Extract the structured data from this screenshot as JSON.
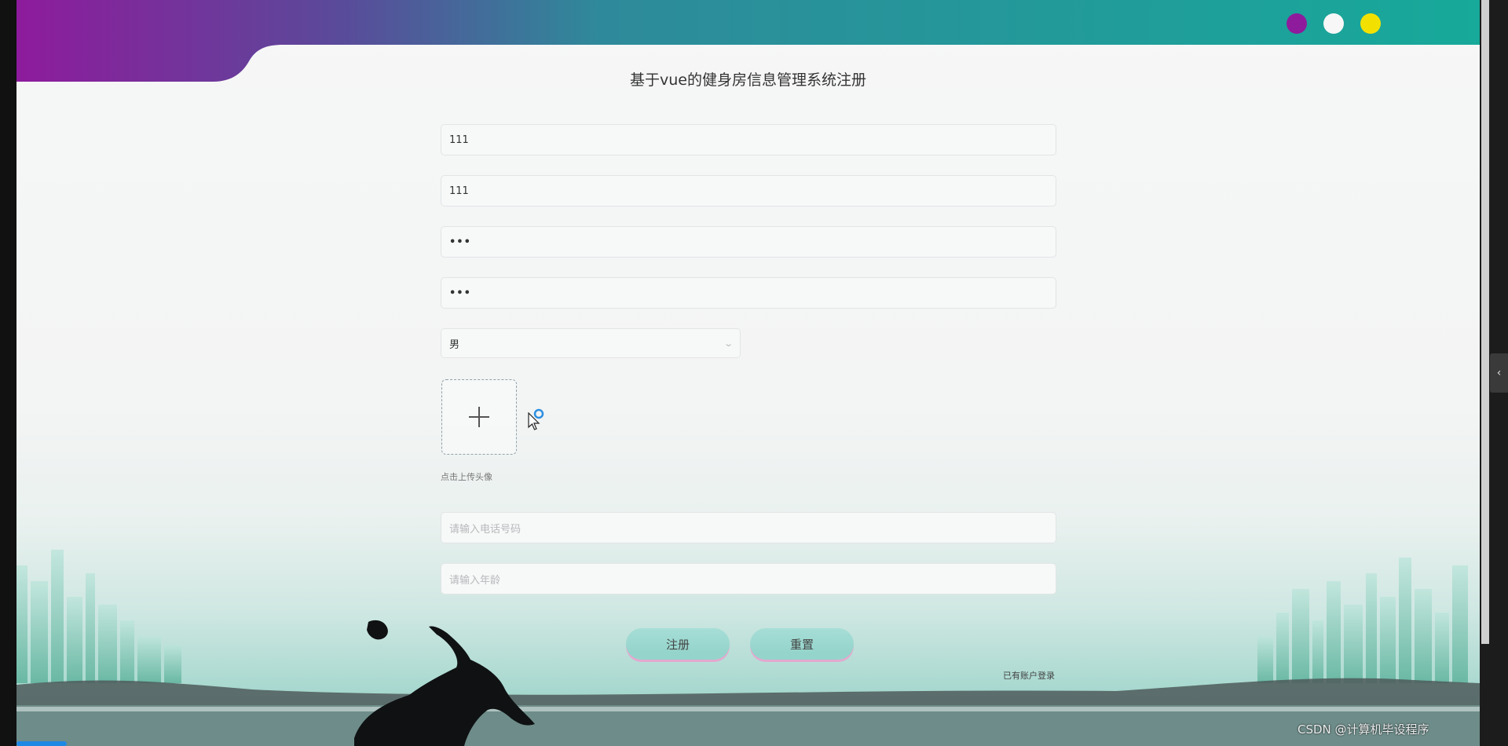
{
  "page": {
    "title": "基于vue的健身房信息管理系统注册"
  },
  "header": {
    "theme_dots": [
      {
        "name": "purple",
        "color": "#8e1b9c"
      },
      {
        "name": "white",
        "color": "#f7f7f7"
      },
      {
        "name": "yellow",
        "color": "#f2e100"
      }
    ]
  },
  "form": {
    "account": {
      "value": "111"
    },
    "name": {
      "value": "111"
    },
    "password": {
      "value": "•••"
    },
    "confirm_password": {
      "value": "•••"
    },
    "gender": {
      "value": "男"
    },
    "avatar": {
      "hint": "点击上传头像"
    },
    "phone": {
      "placeholder": "请输入电话号码"
    },
    "age": {
      "placeholder": "请输入年龄"
    },
    "register_label": "注册",
    "reset_label": "重置",
    "login_link": "已有账户登录"
  },
  "overlay": {
    "watermark": "CSDN @计算机毕设程序"
  },
  "colors": {
    "banner_start": "#8e1b9c",
    "banner_end": "#17a99a",
    "button": "#9bd8cf",
    "button_shadow": "#e3a8cf"
  }
}
